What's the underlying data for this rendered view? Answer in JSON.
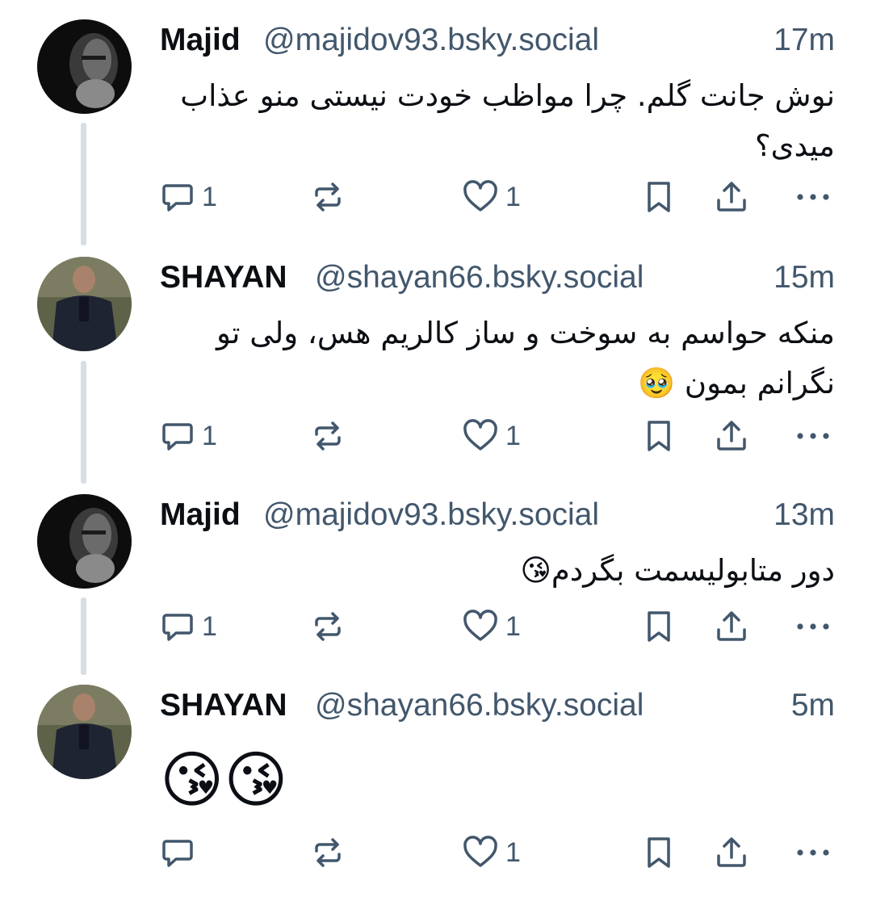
{
  "posts": [
    {
      "display_name": "Majid",
      "handle": "@majidov93.bsky.social",
      "time": "17m",
      "text_lines": [
        "نوش جانت گلم. چرا مواظب خودت نیستی منو عذاب",
        "میدی؟"
      ],
      "avatar": "dark-portrait-avatar",
      "reply_count": "1",
      "repost_count": "",
      "like_count": "1"
    },
    {
      "display_name": "SHAYAN",
      "handle": "@shayan66.bsky.social",
      "time": "15m",
      "text_lines": [
        "منکه حواسم به سوخت و ساز کالریم هس، ولی تو",
        "نگرانم بمون 🥹"
      ],
      "avatar": "jacket-portrait-avatar",
      "reply_count": "1",
      "repost_count": "",
      "like_count": "1"
    },
    {
      "display_name": "Majid",
      "handle": "@majidov93.bsky.social",
      "time": "13m",
      "text_lines": [
        "دور متابولیسمت بگردم😘"
      ],
      "avatar": "dark-portrait-avatar",
      "reply_count": "1",
      "repost_count": "",
      "like_count": "1"
    },
    {
      "display_name": "SHAYAN",
      "handle": "@shayan66.bsky.social",
      "time": "5m",
      "text_lines": [
        "😘😘"
      ],
      "avatar": "jacket-portrait-avatar",
      "reply_count": "",
      "repost_count": "",
      "like_count": "1"
    }
  ],
  "icons": {
    "reply": "reply-icon",
    "repost": "repost-icon",
    "like": "heart-icon",
    "bookmark": "bookmark-icon",
    "share": "share-icon",
    "more": "more-icon"
  },
  "colors": {
    "text": "#0b0f14",
    "muted": "#42576c",
    "thread_line": "#d5dde5"
  }
}
